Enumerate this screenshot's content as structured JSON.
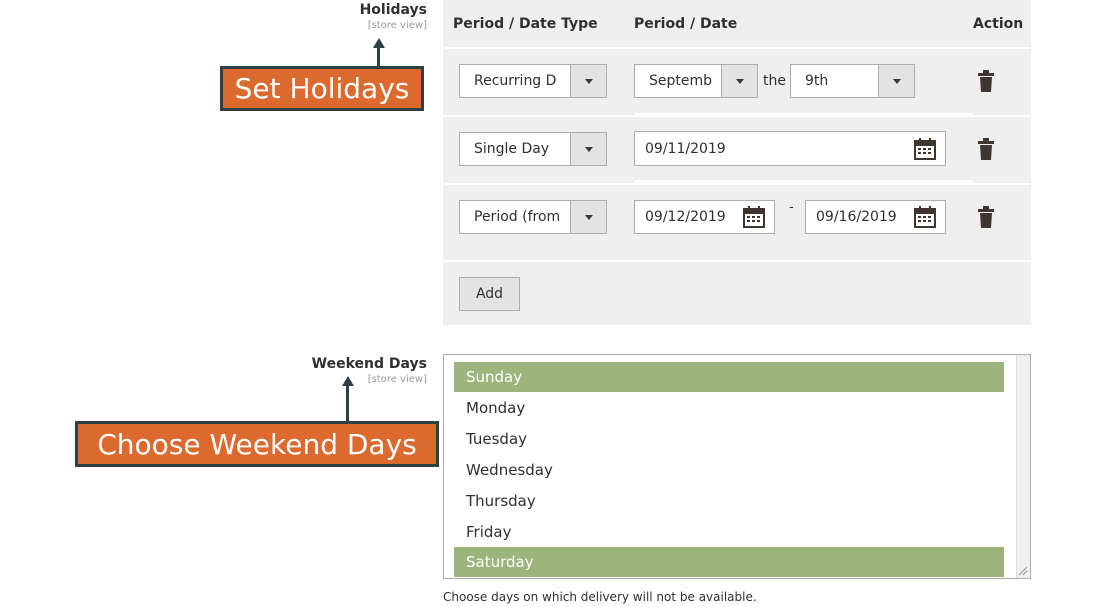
{
  "holidays": {
    "label": "Holidays",
    "scope": "[store view]",
    "callout": "Set Holidays",
    "columns": {
      "type": "Period / Date Type",
      "date": "Period / Date",
      "action": "Action"
    },
    "rows": [
      {
        "type": "Recurring D",
        "month": "Septemb",
        "connector": "the",
        "day": "9th"
      },
      {
        "type": "Single Day",
        "date": "09/11/2019"
      },
      {
        "type": "Period (from",
        "from": "09/12/2019",
        "separator": "-",
        "to": "09/16/2019"
      }
    ],
    "add_label": "Add"
  },
  "weekend": {
    "label": "Weekend Days",
    "scope": "[store view]",
    "callout": "Choose Weekend Days",
    "options": [
      {
        "label": "Sunday",
        "selected": true
      },
      {
        "label": "Monday",
        "selected": false
      },
      {
        "label": "Tuesday",
        "selected": false
      },
      {
        "label": "Wednesday",
        "selected": false
      },
      {
        "label": "Thursday",
        "selected": false
      },
      {
        "label": "Friday",
        "selected": false
      },
      {
        "label": "Saturday",
        "selected": true
      }
    ],
    "note": "Choose days on which delivery will not be available."
  },
  "icons": {
    "dropdown": "caret-down-icon",
    "calendar": "calendar-icon",
    "delete": "trash-icon"
  },
  "colors": {
    "callout_bg": "#dc6a2e",
    "callout_border": "#2f3f45",
    "selected_option": "#9db47c",
    "table_bg": "#efefef"
  }
}
